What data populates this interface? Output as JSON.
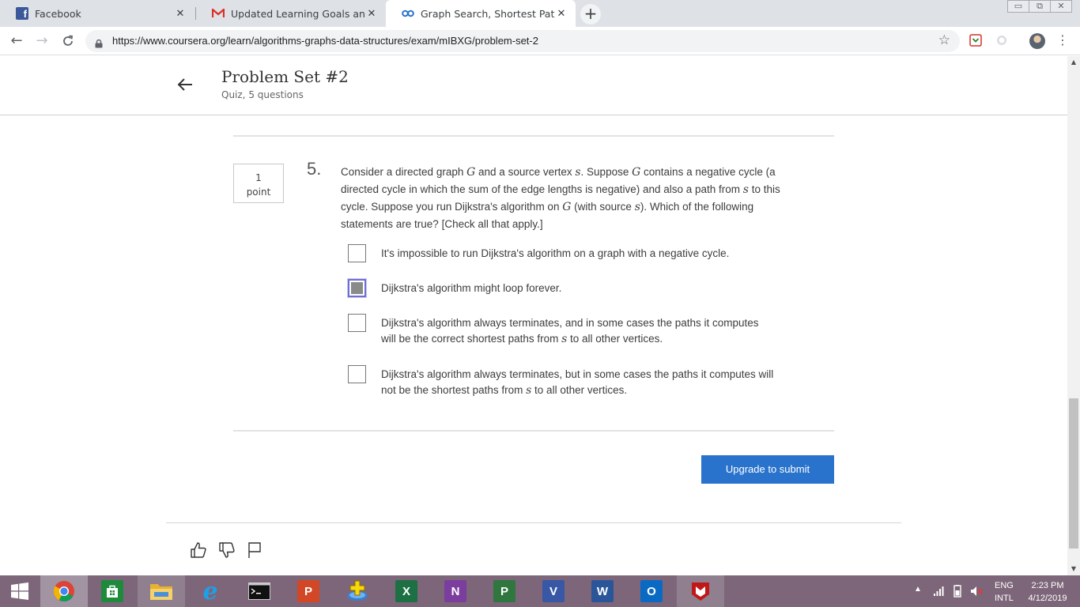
{
  "browser": {
    "tabs": [
      {
        "title": "Facebook",
        "icon": "facebook-icon"
      },
      {
        "title": "Updated Learning Goals and Tim",
        "icon": "gmail-icon"
      },
      {
        "title": "Graph Search, Shortest Paths, an",
        "icon": "coursera-icon"
      }
    ],
    "window_controls": {
      "minimize": "▭",
      "restore": "⧉",
      "close": "✕"
    },
    "url": "https://www.coursera.org/learn/algorithms-graphs-data-structures/exam/mIBXG/problem-set-2"
  },
  "header": {
    "title": "Problem Set #2",
    "subtitle": "Quiz, 5 questions"
  },
  "question": {
    "points_value": "1",
    "points_label": "point",
    "number": "5.",
    "text": {
      "p1": "Consider a directed graph ",
      "m1": "G",
      "p2": " and a source vertex ",
      "m2": "s",
      "p3": ". Suppose ",
      "m3": "G",
      "p4": " contains a negative cycle (a directed cycle in which the sum of the edge lengths is negative) and also a path from ",
      "m4": "s",
      "p5": " to this cycle. Suppose you run Dijkstra's algorithm on ",
      "m5": "G",
      "p6": " (with source ",
      "m6": "s",
      "p7": "). Which of the following statements are true? [Check all that apply.]"
    },
    "options": [
      {
        "text": "It's impossible to run Dijkstra's algorithm on a graph with a negative cycle.",
        "checked": false
      },
      {
        "text": "Dijkstra's algorithm might loop forever.",
        "checked": true
      },
      {
        "a": "Dijkstra's algorithm always terminates, and in some cases the paths it computes will be the correct shortest paths from ",
        "m": "s",
        "b": " to all other vertices.",
        "checked": false
      },
      {
        "a": "Dijkstra's algorithm always terminates, but in some cases the paths it computes will not be the shortest paths from ",
        "m": "s",
        "b": " to all other vertices.",
        "checked": false
      }
    ]
  },
  "submit_label": "Upgrade to submit",
  "footer_icons": [
    "thumbs-up-icon",
    "thumbs-down-icon",
    "flag-icon"
  ],
  "taskbar": {
    "apps": [
      "windows-start-icon",
      "chrome-icon",
      "store-icon",
      "file-explorer-icon",
      "internet-explorer-icon",
      "command-prompt-icon",
      "powerpoint-icon",
      "game-icon",
      "excel-icon",
      "onenote-icon",
      "project-icon",
      "visio-icon",
      "word-icon",
      "outlook-icon",
      "mcafee-icon"
    ],
    "tiles": {
      "powerpoint": "P",
      "excel": "X",
      "onenote": "N",
      "project": "P",
      "visio": "V",
      "word": "W",
      "outlook": "O"
    },
    "lang_1": "ENG",
    "lang_2": "INTL",
    "time": "2:23 PM",
    "date": "4/12/2019"
  },
  "colors": {
    "submit_bg": "#2a73cc",
    "taskbar_bg": "#7d6679",
    "checkbox_focus": "#6f6fd1"
  }
}
